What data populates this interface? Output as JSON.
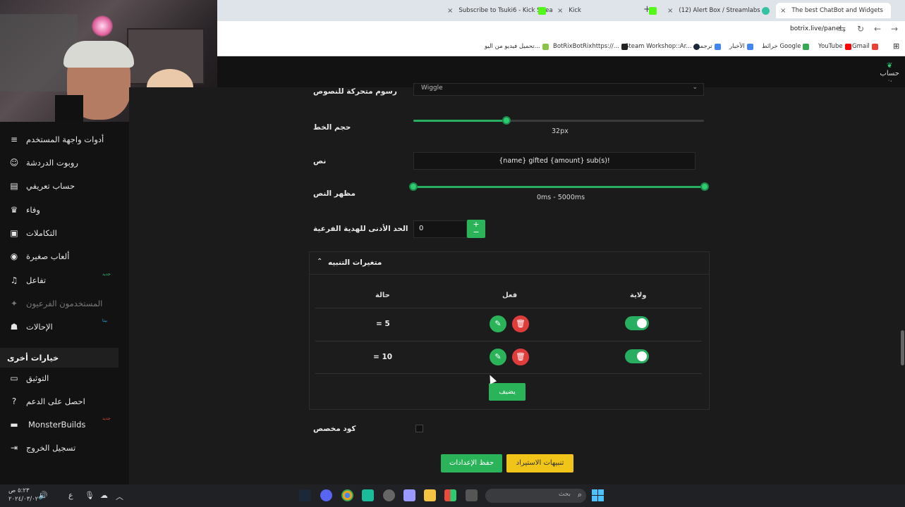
{
  "browser": {
    "tabs": [
      {
        "title": "Subscribe to Tsuki6 - Kick Strea",
        "favicon_color": "#53fc18"
      },
      {
        "title": "Kick",
        "favicon_color": "#53fc18"
      },
      {
        "title": "(12) Alert Box / Streamlabs",
        "favicon_color": "#31c3a2"
      },
      {
        "title": "The best ChatBot and Widgets",
        "favicon_color": "#333333"
      }
    ],
    "new_tab": "+",
    "close_glyph": "×",
    "url": "botrix.live/panel",
    "bookmarks": [
      {
        "label": "Gmail",
        "color": "#ea4335"
      },
      {
        "label": "YouTube",
        "color": "#ff0000"
      },
      {
        "label": "خرائط Google",
        "color": "#34a853"
      },
      {
        "label": "الأخبار",
        "color": "#4285f4"
      },
      {
        "label": "ترجمة",
        "color": "#4285f4"
      },
      {
        "label": "Steam Workshop::Ar...",
        "color": "#1b2838"
      },
      {
        "label": "BotRixBotRixhttps://...",
        "color": "#222222"
      },
      {
        "label": "تحميل فيديو من اليو...",
        "color": "#8bc34a"
      }
    ]
  },
  "topnav": {
    "account_label": "حساب",
    "account_sub": "٠،"
  },
  "sidebar": {
    "items": [
      {
        "label": "أدوات واجهة المستخدم",
        "icon": "≡",
        "dim": false
      },
      {
        "label": "روبوت الدردشة",
        "icon": "☺",
        "dim": false
      },
      {
        "label": "حساب تعريفي",
        "icon": "▤",
        "dim": false
      },
      {
        "label": "وفاء",
        "icon": "♛",
        "dim": false
      },
      {
        "label": "التكاملات",
        "icon": "▣",
        "dim": false
      },
      {
        "label": "ألعاب صغيرة",
        "icon": "◉",
        "dim": false
      },
      {
        "label": "تفاعل",
        "icon": "♫",
        "dim": false,
        "badge": "جديد"
      },
      {
        "label": "المستخدمون الفرعيون",
        "icon": "✦",
        "dim": true
      },
      {
        "label": "الإحالات",
        "icon": "☗",
        "dim": false,
        "badge": "بيتا"
      }
    ],
    "section_title": "خيارات أخرى",
    "other_items": [
      {
        "label": "التوثيق",
        "icon": "▭"
      },
      {
        "label": "احصل على الدعم",
        "icon": "?"
      },
      {
        "label": "MonsterBuilds",
        "icon": "▬",
        "badge": "جديد"
      },
      {
        "label": "تسجيل الخروج",
        "icon": "⇥"
      }
    ]
  },
  "settings": {
    "text_animation": {
      "label": "رسوم متحركة للنصوص",
      "value": "Wiggle",
      "chevron": "⌄"
    },
    "font_size": {
      "label": "حجم الخط",
      "value_text": "32px",
      "value": 32,
      "max": 100
    },
    "text": {
      "label": "نص",
      "value": "{name} gifted {amount} sub(s)!"
    },
    "text_appearance": {
      "label": "مظهر النص",
      "value_text": "0ms - 5000ms",
      "min": 0,
      "max": 5000
    },
    "min_gift": {
      "label": "الحد الأدنى للهدية الفرعية",
      "value": "0",
      "plus": "+",
      "minus": "−"
    },
    "variations": {
      "title": "متغيرات التنبيه",
      "chevron": "⌃",
      "columns": {
        "condition": "حالة",
        "action": "فعل",
        "state": "ولاية"
      },
      "rows": [
        {
          "condition": "= 5",
          "enabled": true
        },
        {
          "condition": "= 10",
          "enabled": true
        }
      ],
      "edit_icon": "✎",
      "delete_icon": "🗑",
      "add_label": "يضيف"
    },
    "custom_code": {
      "label": "كود مخصص"
    }
  },
  "footer": {
    "save_label": "حفظ الإعدادات",
    "alerts_label": "تنبيهات الاستيراد"
  },
  "taskbar": {
    "clock_time": "٥:٢٣ ص",
    "clock_date": "٢٠٢٤/٠٣/٠٢",
    "search_placeholder": "بحث",
    "search_icon": "⌕",
    "lang": "ع",
    "tray_chevron": "︿",
    "tray_icons": [
      "🔊",
      "🎙",
      "☁"
    ],
    "apps": [
      {
        "name": "steam",
        "color": "#1b2838"
      },
      {
        "name": "discord",
        "color": "#5865f2"
      },
      {
        "name": "chrome",
        "color": "#e8a41c"
      },
      {
        "name": "app-green",
        "color": "#1abc9c"
      },
      {
        "name": "settings",
        "color": "#666666"
      },
      {
        "name": "adobe",
        "color": "#9999ff"
      },
      {
        "name": "explorer",
        "color": "#f4c542"
      },
      {
        "name": "app-multi",
        "color": "#e74c3c"
      },
      {
        "name": "terminal",
        "color": "#555555"
      }
    ]
  }
}
